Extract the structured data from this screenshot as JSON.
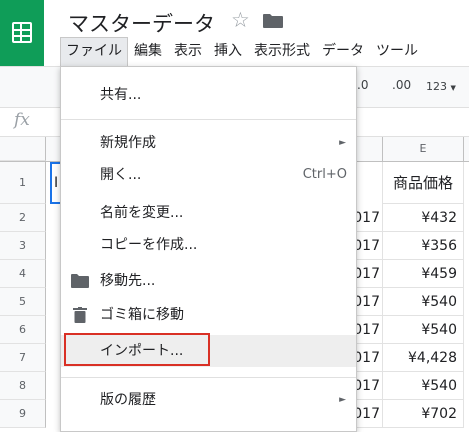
{
  "app": {
    "title": "マスターデータ",
    "brand_color": "#0f9d58"
  },
  "menubar": {
    "items": [
      "ファイル",
      "編集",
      "表示",
      "挿入",
      "表示形式",
      "データ",
      "ツール"
    ]
  },
  "toolbar": {
    "decimal_decrease": ".0",
    "decimal_increase": ".00",
    "more_formats": "123"
  },
  "formula_bar": {
    "fx_label": "fx"
  },
  "sheet": {
    "column_e_header": "E",
    "e1_header": "商品価格",
    "a1_partial": "I",
    "rows": [
      {
        "num": "1"
      },
      {
        "num": "2",
        "d": "017",
        "e": "¥432"
      },
      {
        "num": "3",
        "d": "017",
        "e": "¥356"
      },
      {
        "num": "4",
        "d": "017",
        "e": "¥459"
      },
      {
        "num": "5",
        "d": "017",
        "e": "¥540"
      },
      {
        "num": "6",
        "d": "017",
        "e": "¥540"
      },
      {
        "num": "7",
        "d": "017",
        "e": "¥4,428"
      },
      {
        "num": "8",
        "d": "017",
        "e": "¥540"
      },
      {
        "num": "9",
        "d": "017",
        "e": "¥702"
      }
    ]
  },
  "file_menu": {
    "share": "共有...",
    "new": "新規作成",
    "open": "開く...",
    "open_shortcut": "Ctrl+O",
    "rename": "名前を変更...",
    "make_copy": "コピーを作成...",
    "move_to": "移動先...",
    "move_to_trash": "ゴミ箱に移動",
    "import": "インポート...",
    "version_history": "版の履歴"
  },
  "highlight_color": "#d93025"
}
